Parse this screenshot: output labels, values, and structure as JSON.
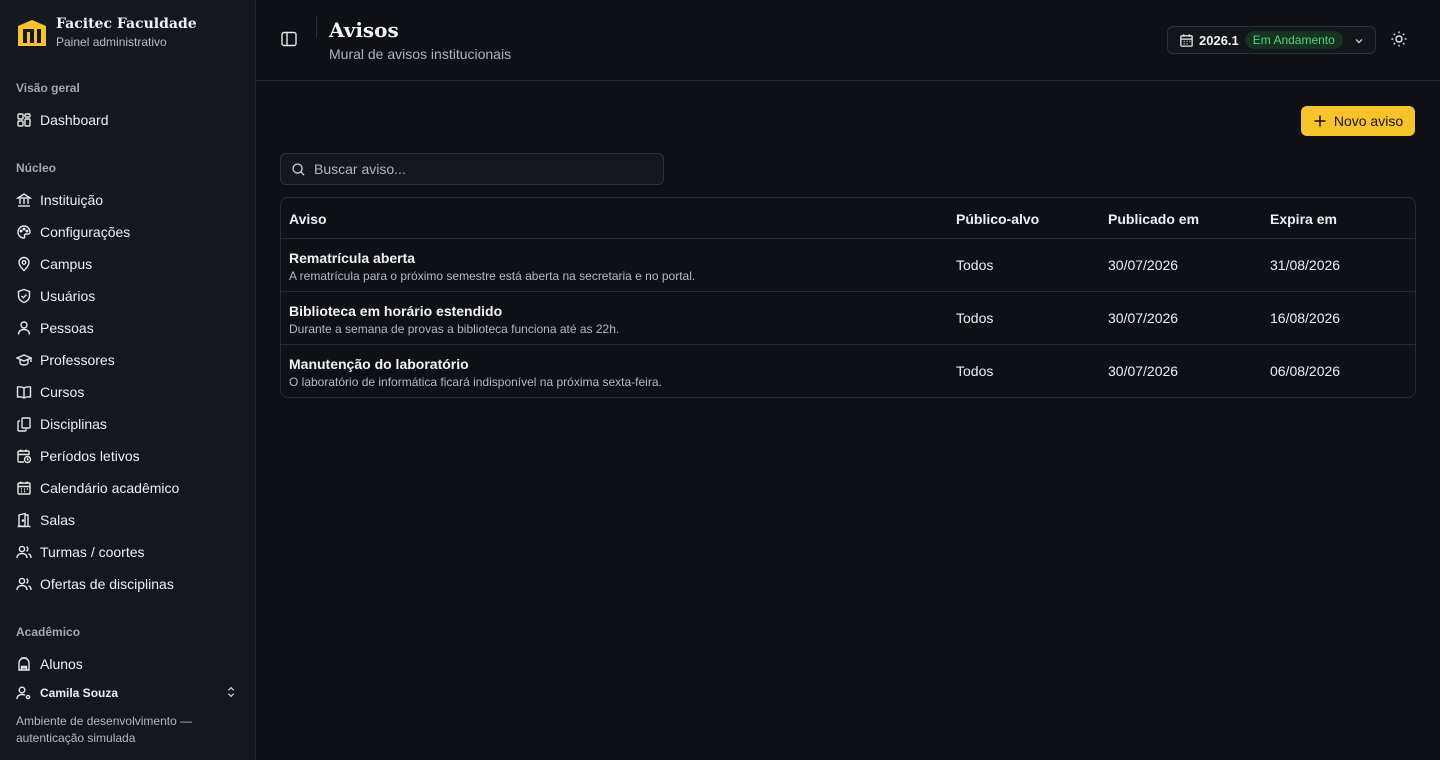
{
  "brand": {
    "title": "Facitec Faculdade",
    "subtitle": "Painel administrativo",
    "logo_color": "#f6c428"
  },
  "sidebar": {
    "sections": [
      {
        "label": "Visão geral",
        "items": [
          {
            "label": "Dashboard",
            "icon": "grid-icon"
          }
        ]
      },
      {
        "label": "Núcleo",
        "items": [
          {
            "label": "Instituição",
            "icon": "bank-icon"
          },
          {
            "label": "Configurações",
            "icon": "palette-icon"
          },
          {
            "label": "Campus",
            "icon": "map-pin-icon"
          },
          {
            "label": "Usuários",
            "icon": "shield-icon"
          },
          {
            "label": "Pessoas",
            "icon": "user-icon"
          },
          {
            "label": "Professores",
            "icon": "graduation-cap-icon"
          },
          {
            "label": "Cursos",
            "icon": "book-open-icon"
          },
          {
            "label": "Disciplinas",
            "icon": "files-icon"
          },
          {
            "label": "Períodos letivos",
            "icon": "calendar-clock-icon"
          },
          {
            "label": "Calendário acadêmico",
            "icon": "calendar-icon"
          },
          {
            "label": "Salas",
            "icon": "door-icon"
          },
          {
            "label": "Turmas / coortes",
            "icon": "users-icon"
          },
          {
            "label": "Ofertas de disciplinas",
            "icon": "users-icon"
          }
        ]
      },
      {
        "label": "Acadêmico",
        "items": [
          {
            "label": "Alunos",
            "icon": "backpack-icon"
          }
        ]
      }
    ],
    "user": {
      "name": "Camila Souza",
      "icon": "user-cog-icon"
    },
    "env_note": "Ambiente de desenvolvimento — autenticação simulada"
  },
  "header": {
    "title": "Avisos",
    "subtitle": "Mural de avisos institucionais",
    "period": {
      "year": "2026.1",
      "status": "Em Andamento",
      "status_color": "#4fd381"
    }
  },
  "toolbar": {
    "new_label": "Novo aviso",
    "search_placeholder": "Buscar aviso..."
  },
  "table": {
    "columns": [
      "Aviso",
      "Público-alvo",
      "Publicado em",
      "Expira em"
    ],
    "rows": [
      {
        "title": "Rematrícula aberta",
        "description": "A rematrícula para o próximo semestre está aberta na secretaria e no portal.",
        "audience": "Todos",
        "published": "30/07/2026",
        "expires": "31/08/2026"
      },
      {
        "title": "Biblioteca em horário estendido",
        "description": "Durante a semana de provas a biblioteca funciona até as 22h.",
        "audience": "Todos",
        "published": "30/07/2026",
        "expires": "16/08/2026"
      },
      {
        "title": "Manutenção do laboratório",
        "description": "O laboratório de informática ficará indisponível na próxima sexta-feira.",
        "audience": "Todos",
        "published": "30/07/2026",
        "expires": "06/08/2026"
      }
    ]
  },
  "colors": {
    "accent": "#f6c428",
    "background": "#0e1015",
    "sidebar": "#14171d"
  }
}
